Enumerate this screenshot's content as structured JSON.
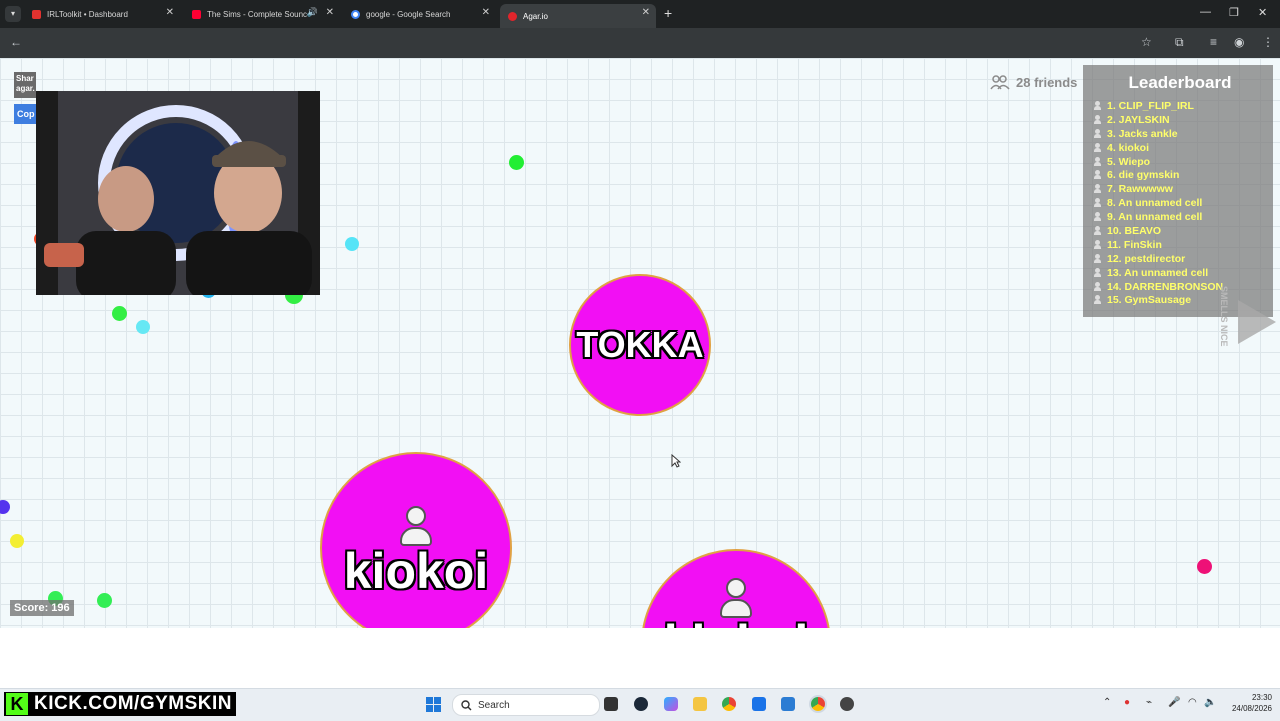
{
  "browser": {
    "tabs": [
      {
        "title": "IRLToolkit • Dashboard",
        "icon": "irltoolkit-icon",
        "active": false
      },
      {
        "title": "The Sims - Complete Sounc",
        "icon": "youtube-icon",
        "active": false
      },
      {
        "title": "google - Google Search",
        "icon": "google-icon",
        "active": false
      },
      {
        "title": "Agar.io",
        "icon": "agario-icon",
        "active": true
      }
    ]
  },
  "game": {
    "share_label": "Shar agar.",
    "copy_label": "Cop",
    "friends": "28 friends",
    "leaderboard": {
      "title": "Leaderboard",
      "entries": [
        "1. CLIP_FLIP_IRL",
        "2. JAYLSKIN",
        "3. Jacks ankle",
        "4. kiokoi",
        "5. Wiepo",
        "6. die gymskin",
        "7. Rawwwww",
        "8. An unnamed cell",
        "9. An unnamed cell",
        "10. BEAVO",
        "11. FinSkin",
        "12. pestdirector",
        "13. An unnamed cell",
        "14. DARRENBRONSON",
        "15. GymSausage"
      ]
    },
    "side_text": "SMELLS NICE",
    "cells": {
      "tokka": "TOKKA",
      "kiokoi": "kiokoi",
      "kiokoi2": "kiokoi"
    },
    "score": "Score: 196"
  },
  "overlay": {
    "kick_url": "KICK.COM/GYMSKIN"
  },
  "taskbar": {
    "search_placeholder": "Search",
    "time": "23:30",
    "date": "24/08/2026"
  },
  "colors": {
    "cell_fill": "#f20ff4",
    "cell_border": "#e0a143",
    "leaderboard_text": "#ffff6a",
    "kick_green": "#53fc18"
  }
}
